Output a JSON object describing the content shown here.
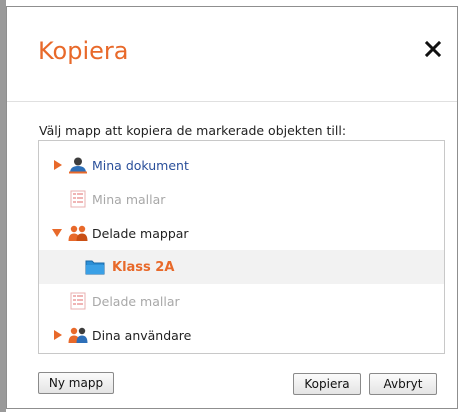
{
  "dialog": {
    "title": "Kopiera",
    "close_icon": "close-icon",
    "instruction": "Välj mapp att kopiera de markerade objekten till:"
  },
  "tree": {
    "items": [
      {
        "label": "Mina dokument",
        "icon": "user-icon",
        "expander": "collapsed"
      },
      {
        "label": "Mina mallar",
        "icon": "template-icon",
        "expander": "none"
      },
      {
        "label": "Delade mappar",
        "icon": "group-icon",
        "expander": "expanded"
      },
      {
        "label": "Klass 2A",
        "icon": "folder-icon",
        "expander": "none",
        "selected": true
      },
      {
        "label": "Delade mallar",
        "icon": "template-icon",
        "expander": "none"
      },
      {
        "label": "Dina användare",
        "icon": "group-icon",
        "expander": "collapsed"
      }
    ]
  },
  "buttons": {
    "new_folder": "Ny mapp",
    "copy": "Kopiera",
    "cancel": "Avbryt"
  },
  "colors": {
    "accent": "#e8692a",
    "link": "#2a4f9a",
    "disabled": "#a8a8a8",
    "folder": "#2b8fd6"
  }
}
